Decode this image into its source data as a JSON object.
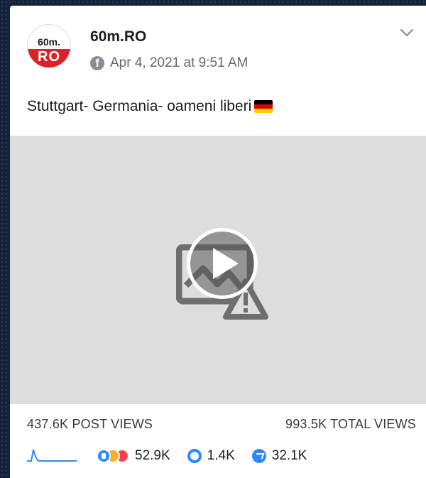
{
  "post": {
    "page_name": "60m.RO",
    "avatar": {
      "top_text": "60m.",
      "bottom_text": "RO"
    },
    "timestamp": "Apr 4, 2021 at 9:51 AM",
    "caption": "Stuttgart- Germania- oameni liberi",
    "flag_colors": [
      "#000000",
      "#dd0000",
      "#ffce00"
    ],
    "menu_icon": "chevron-down-icon"
  },
  "video": {
    "icon": "broken-image-icon",
    "play_icon": "play-icon"
  },
  "stats": {
    "post_views": "437.6K POST VIEWS",
    "total_views": "993.5K TOTAL VIEWS",
    "reactions": "52.9K",
    "comments": "1.4K",
    "shares": "32.1K"
  },
  "colors": {
    "brand_red": "#d8232a",
    "facebook_blue": "#2d88ff",
    "text_gray": "#65676b"
  }
}
